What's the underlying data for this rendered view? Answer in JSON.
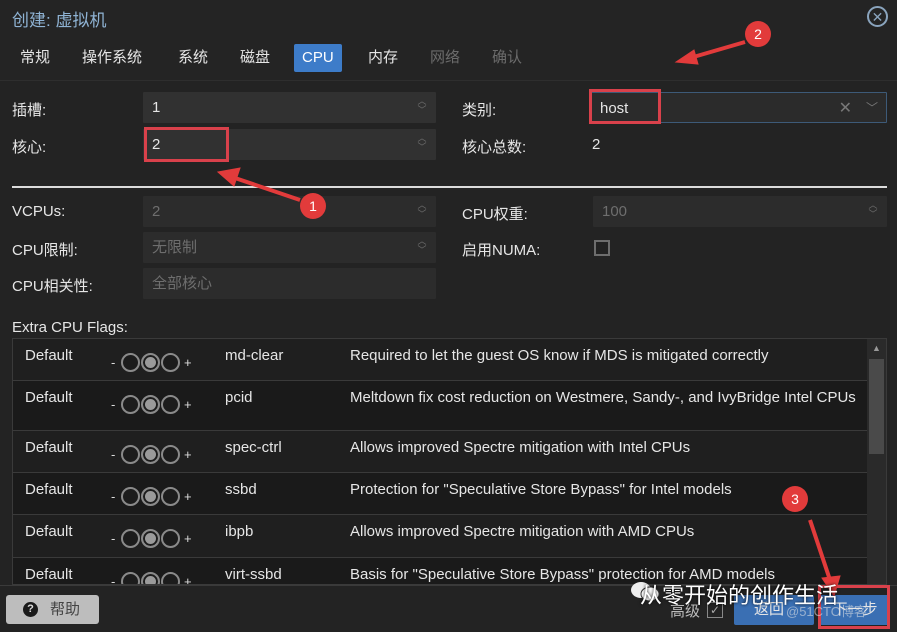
{
  "window": {
    "title": "创建: 虚拟机",
    "close_icon": "circle-x-icon"
  },
  "tabs": [
    {
      "label": "常规",
      "state": "normal"
    },
    {
      "label": "操作系统",
      "state": "normal"
    },
    {
      "label": "系统",
      "state": "normal"
    },
    {
      "label": "磁盘",
      "state": "normal"
    },
    {
      "label": "CPU",
      "state": "active"
    },
    {
      "label": "内存",
      "state": "normal"
    },
    {
      "label": "网络",
      "state": "disabled"
    },
    {
      "label": "确认",
      "state": "disabled"
    }
  ],
  "form": {
    "sockets": {
      "label": "插槽:",
      "value": "1"
    },
    "cores": {
      "label": "核心:",
      "value": "2"
    },
    "type": {
      "label": "类别:",
      "value": "host"
    },
    "total_cores": {
      "label": "核心总数:",
      "value": "2"
    },
    "vcpus": {
      "label": "VCPUs:",
      "value": "2"
    },
    "cpu_limit": {
      "label": "CPU限制:",
      "placeholder": "无限制"
    },
    "cpu_affinity": {
      "label": "CPU相关性:",
      "placeholder": "全部核心"
    },
    "cpu_weight": {
      "label": "CPU权重:",
      "placeholder": "100"
    },
    "numa": {
      "label": "启用NUMA:",
      "checked": false
    }
  },
  "flags": {
    "label": "Extra CPU Flags:",
    "rows": [
      {
        "state": "Default",
        "name": "md-clear",
        "description": "Required to let the guest OS know if MDS is mitigated correctly"
      },
      {
        "state": "Default",
        "name": "pcid",
        "description": "Meltdown fix cost reduction on Westmere, Sandy-, and IvyBridge Intel CPUs"
      },
      {
        "state": "Default",
        "name": "spec-ctrl",
        "description": "Allows improved Spectre mitigation with Intel CPUs"
      },
      {
        "state": "Default",
        "name": "ssbd",
        "description": "Protection for \"Speculative Store Bypass\" for Intel models"
      },
      {
        "state": "Default",
        "name": "ibpb",
        "description": "Allows improved Spectre mitigation with AMD CPUs"
      },
      {
        "state": "Default",
        "name": "virt-ssbd",
        "description": "Basis for \"Speculative Store Bypass\" protection for AMD models"
      }
    ],
    "minus": "-",
    "plus": "+"
  },
  "footer": {
    "help_label": "帮助",
    "help_icon": "?",
    "advanced_label": "高级",
    "advanced_checked": true,
    "back_label": "返回",
    "next_label": "下一步"
  },
  "annotations": {
    "badges": [
      "1",
      "2",
      "3"
    ],
    "accent": "#e23b3b"
  },
  "watermark": {
    "text": "从零开始的创作生活",
    "small": "@51CTO博客"
  },
  "colors": {
    "accent_blue": "#3d7cc9",
    "background": "#242424"
  }
}
